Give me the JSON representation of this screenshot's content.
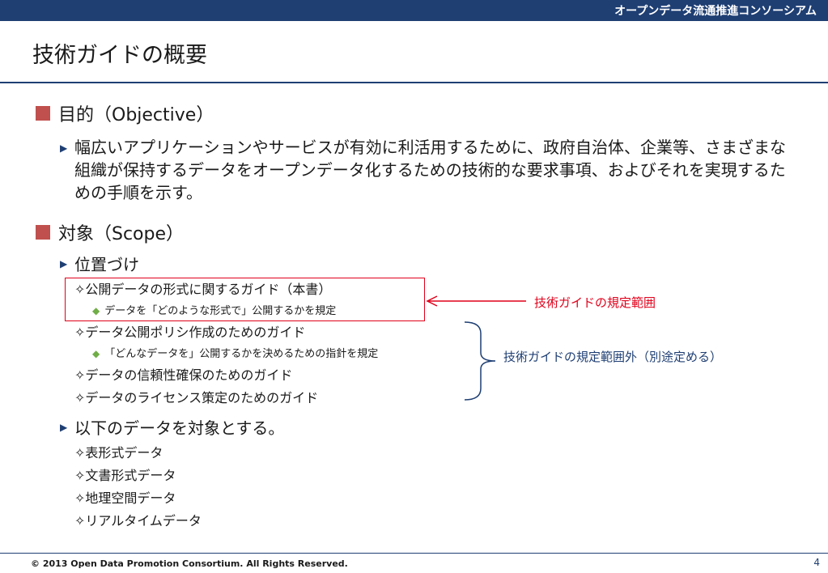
{
  "header": {
    "organization": "オープンデータ流通推進コンソーシアム"
  },
  "slide": {
    "title": "技術ガイドの概要"
  },
  "sections": {
    "objective": {
      "heading": "目的（Objective）",
      "text": "幅広いアプリケーションやサービスが有効に利活用するために、政府自治体、企業等、さまざまな組織が保持するデータをオープンデータ化するための技術的な要求事項、およびそれを実現するための手順を示す。"
    },
    "scope": {
      "heading": "対象（Scope）",
      "positioning": {
        "label": "位置づけ",
        "items": [
          "✧公開データの形式に関するガイド（本書）",
          "データを「どのような形式で」公開するかを規定",
          "✧データ公開ポリシ作成のためのガイド",
          "「どんなデータを」公開するかを決めるための指針を規定",
          "✧データの信頼性確保のためのガイド",
          "✧データのライセンス策定のためのガイド"
        ]
      },
      "targets": {
        "label": "以下のデータを対象とする。",
        "items": [
          "✧表形式データ",
          "✧文書形式データ",
          "✧地理空間データ",
          "✧リアルタイムデータ"
        ]
      }
    }
  },
  "annotations": {
    "in_scope": "技術ガイドの規定範囲",
    "out_of_scope": "技術ガイドの規定範囲外（別途定める）"
  },
  "footer": {
    "copyright": "© 2013 Open Data Promotion Consortium. All Rights Reserved.",
    "page_number": "4"
  },
  "colors": {
    "brand_navy": "#1f3f73",
    "bullet_red": "#c0504d",
    "highlight_red": "#e0001a",
    "sub_bullet_green": "#70ad47"
  }
}
